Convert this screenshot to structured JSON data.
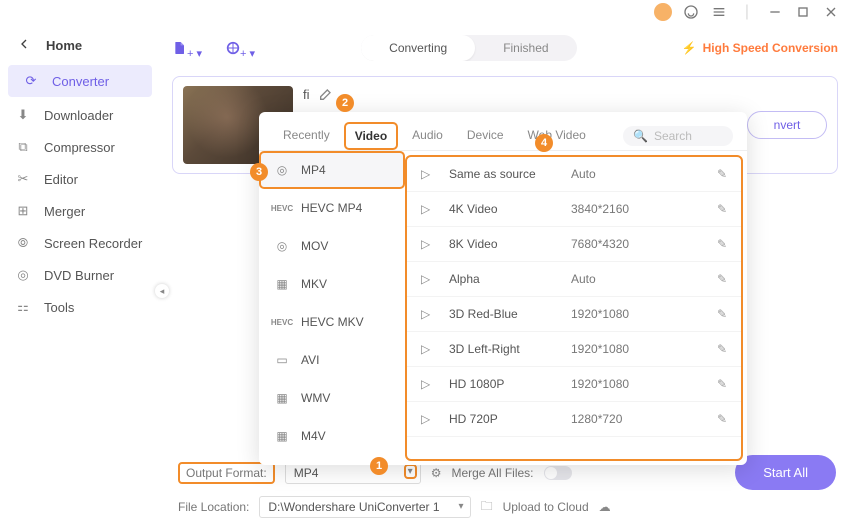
{
  "titlebar": {},
  "sidebar": {
    "home": "Home",
    "items": [
      {
        "label": "Converter"
      },
      {
        "label": "Downloader"
      },
      {
        "label": "Compressor"
      },
      {
        "label": "Editor"
      },
      {
        "label": "Merger"
      },
      {
        "label": "Screen Recorder"
      },
      {
        "label": "DVD Burner"
      },
      {
        "label": "Tools"
      }
    ]
  },
  "top": {
    "converting": "Converting",
    "finished": "Finished",
    "high_speed": "High Speed Conversion"
  },
  "card": {
    "filename_prefix": "fi",
    "convert": "nvert"
  },
  "dropdown": {
    "tabs": [
      "Recently",
      "Video",
      "Audio",
      "Device",
      "Web Video"
    ],
    "active_tab": 1,
    "search_placeholder": "Search",
    "formats": [
      {
        "label": "MP4",
        "icon": "target"
      },
      {
        "label": "HEVC MP4",
        "icon": "hevc"
      },
      {
        "label": "MOV",
        "icon": "target"
      },
      {
        "label": "MKV",
        "icon": "film"
      },
      {
        "label": "HEVC MKV",
        "icon": "hevc"
      },
      {
        "label": "AVI",
        "icon": "window"
      },
      {
        "label": "WMV",
        "icon": "film"
      },
      {
        "label": "M4V",
        "icon": "film"
      }
    ],
    "resolutions": [
      {
        "name": "Same as source",
        "size": "Auto"
      },
      {
        "name": "4K Video",
        "size": "3840*2160"
      },
      {
        "name": "8K Video",
        "size": "7680*4320"
      },
      {
        "name": "Alpha",
        "size": "Auto"
      },
      {
        "name": "3D Red-Blue",
        "size": "1920*1080"
      },
      {
        "name": "3D Left-Right",
        "size": "1920*1080"
      },
      {
        "name": "HD 1080P",
        "size": "1920*1080"
      },
      {
        "name": "HD 720P",
        "size": "1280*720"
      }
    ]
  },
  "footer": {
    "output_format_label": "Output Format:",
    "output_format_value": "MP4",
    "file_location_label": "File Location:",
    "file_location_value": "D:\\Wondershare UniConverter 1",
    "merge_label": "Merge All Files:",
    "upload_label": "Upload to Cloud",
    "start_all": "Start All"
  },
  "badges": {
    "b1": "1",
    "b2": "2",
    "b3": "3",
    "b4": "4"
  }
}
